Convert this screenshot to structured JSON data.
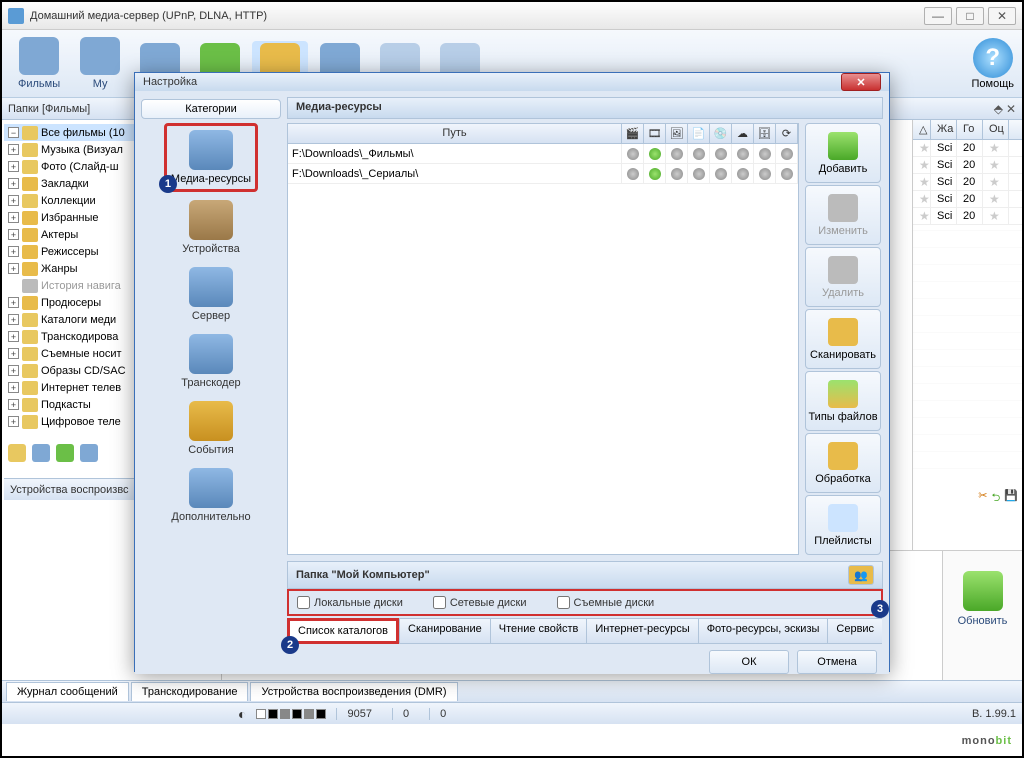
{
  "app": {
    "title": "Домашний медиа-сервер (UPnP, DLNA, HTTP)"
  },
  "toolbar": {
    "films": "Фильмы",
    "music_partial": "Му",
    "help": "Помощь"
  },
  "panel": {
    "caption": "Папки [Фильмы]"
  },
  "tree": {
    "all_films": "Все фильмы (10",
    "music_vis": "Музыка (Визуал",
    "photo_slide": "Фото (Слайд-ш",
    "bookmarks": "Закладки",
    "collections": "Коллекции",
    "favorites": "Избранные",
    "actors": "Актеры",
    "directors": "Режиссеры",
    "genres": "Жанры",
    "history": "История навига",
    "producers": "Продюсеры",
    "media_catalogs": "Каталоги меди",
    "transcoding_t": "Транскодирова",
    "removable": "Съемные носит",
    "cd_images": "Образы CD/SAC",
    "inet_tv": "Интернет телев",
    "podcasts": "Подкасты",
    "digital_tv": "Цифровое теле"
  },
  "devices_box": "Устройства воспроизвс",
  "grid": {
    "headers": {
      "genre": "Жа",
      "year": "Го",
      "rating": "Оц"
    },
    "rows": [
      {
        "genre": "Sci",
        "year": "20"
      },
      {
        "genre": "Sci",
        "year": "20"
      },
      {
        "genre": "Sci",
        "year": "20"
      },
      {
        "genre": "Sci",
        "year": "20"
      },
      {
        "genre": "Sci",
        "year": "20"
      }
    ]
  },
  "actions": {
    "refresh": "Обновить"
  },
  "tabs": {
    "log": "Журнал сообщений",
    "transcoding": "Транскодирование",
    "dmr": "Устройства воспроизведения (DMR)"
  },
  "status": {
    "val1": "9057",
    "val2": "0",
    "val3": "0",
    "version": "В. 1.99.1"
  },
  "watermark": {
    "p1": "mono",
    "p2": "bit"
  },
  "modal": {
    "title": "Настройка",
    "categories": {
      "header": "Категории",
      "media_resources": "Медиа-ресурсы",
      "devices": "Устройства",
      "server": "Сервер",
      "transcoder": "Транскодер",
      "events": "События",
      "additional": "Дополнительно"
    },
    "content": {
      "title": "Медиа-ресурсы",
      "path_header": "Путь",
      "rows": [
        {
          "path": "F:\\Downloads\\_Фильмы\\",
          "flags": [
            false,
            true,
            false,
            false,
            false,
            false,
            false,
            false
          ]
        },
        {
          "path": "F:\\Downloads\\_Сериалы\\",
          "flags": [
            false,
            true,
            false,
            false,
            false,
            false,
            false,
            false
          ]
        }
      ],
      "buttons": {
        "add": "Добавить",
        "edit": "Изменить",
        "delete": "Удалить",
        "scan": "Сканировать",
        "filetypes": "Типы файлов",
        "processing": "Обработка",
        "playlists": "Плейлисты"
      },
      "folder": {
        "title": "Папка \"Мой Компьютер\"",
        "local": "Локальные диски",
        "network": "Сетевые диски",
        "removable": "Съемные диски"
      },
      "subtabs": {
        "cataloglist": "Список каталогов",
        "scanning": "Сканирование",
        "reading": "Чтение свойств",
        "internet": "Интернет-ресурсы",
        "photo": "Фото-ресурсы, эскизы",
        "service": "Сервис"
      }
    },
    "footer": {
      "ok": "ОК",
      "cancel": "Отмена"
    }
  }
}
